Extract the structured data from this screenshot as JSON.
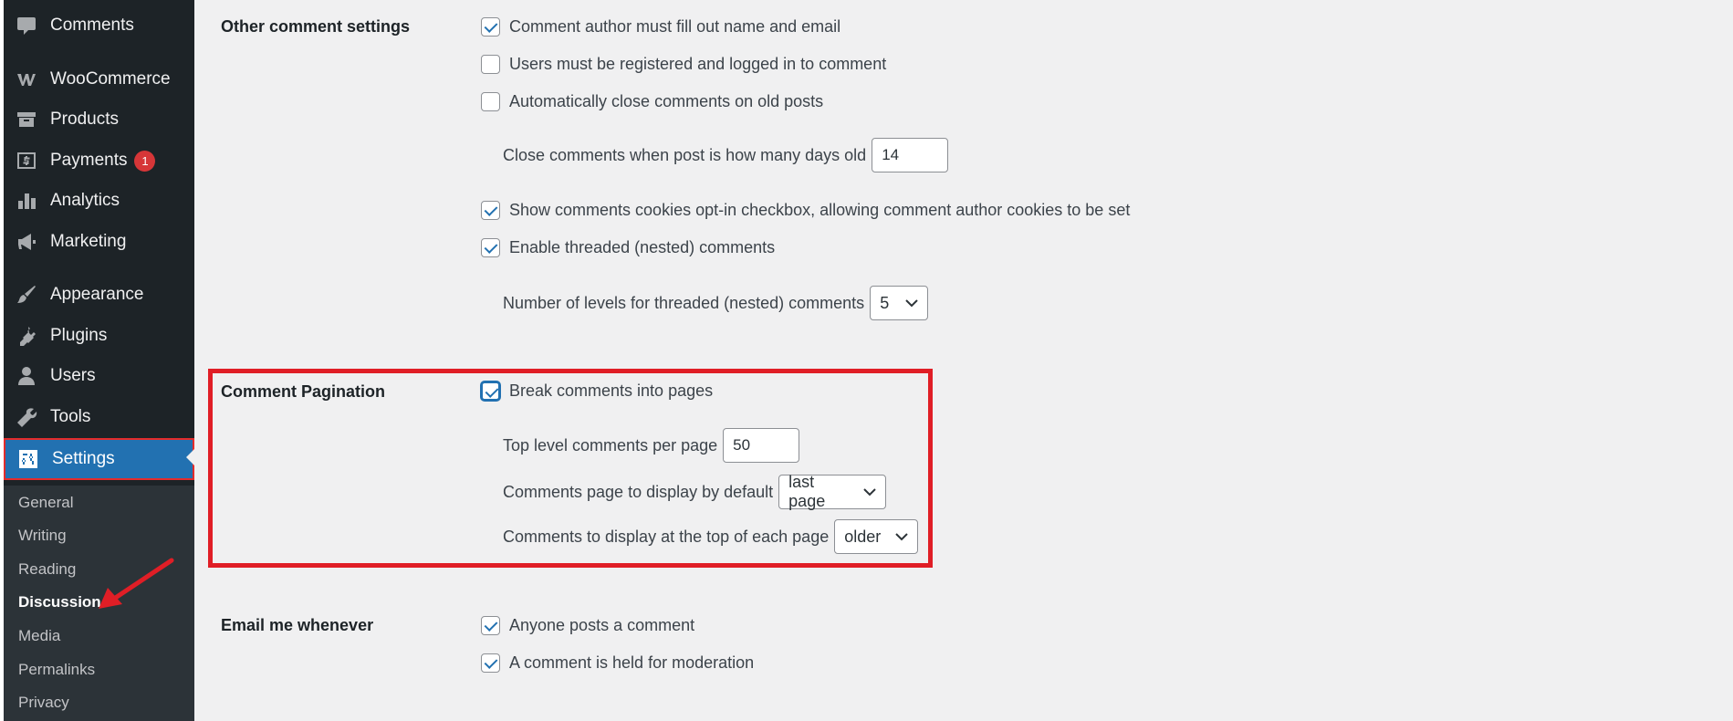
{
  "sidebar": {
    "items": [
      {
        "label": "Comments",
        "icon": "comment-icon"
      },
      {
        "label": "WooCommerce",
        "icon": "woo-icon"
      },
      {
        "label": "Products",
        "icon": "archive-icon"
      },
      {
        "label": "Payments",
        "icon": "money-icon",
        "badge": "1"
      },
      {
        "label": "Analytics",
        "icon": "chart-bar-icon"
      },
      {
        "label": "Marketing",
        "icon": "megaphone-icon"
      },
      {
        "label": "Appearance",
        "icon": "brush-icon"
      },
      {
        "label": "Plugins",
        "icon": "plugin-icon"
      },
      {
        "label": "Users",
        "icon": "user-icon"
      },
      {
        "label": "Tools",
        "icon": "wrench-icon"
      },
      {
        "label": "Settings",
        "icon": "settings-icon",
        "current": true
      }
    ],
    "submenu": [
      "General",
      "Writing",
      "Reading",
      "Discussion",
      "Media",
      "Permalinks",
      "Privacy"
    ],
    "submenu_current": "Discussion"
  },
  "sections": {
    "other": {
      "label": "Other comment settings",
      "require_name_email": "Comment author must fill out name and email",
      "registered_only": "Users must be registered and logged in to comment",
      "auto_close": "Automatically close comments on old posts",
      "close_days_label": "Close comments when post is how many days old",
      "close_days_value": "14",
      "cookies_optin": "Show comments cookies opt-in checkbox, allowing comment author cookies to be set",
      "threaded": "Enable threaded (nested) comments",
      "thread_levels_label": "Number of levels for threaded (nested) comments",
      "thread_levels_value": "5"
    },
    "pagination": {
      "label": "Comment Pagination",
      "break_pages": "Break comments into pages",
      "per_page_label": "Top level comments per page",
      "per_page_value": "50",
      "default_page_label": "Comments page to display by default",
      "default_page_value": "last page",
      "top_order_label": "Comments to display at the top of each page",
      "top_order_value": "older"
    },
    "email": {
      "label": "Email me whenever",
      "anyone_posts": "Anyone posts a comment",
      "held_moderation": "A comment is held for moderation"
    }
  },
  "colors": {
    "accent": "#2271b1",
    "highlight": "#e01e26",
    "sidebar_bg": "#1d2327",
    "badge": "#d63638"
  }
}
